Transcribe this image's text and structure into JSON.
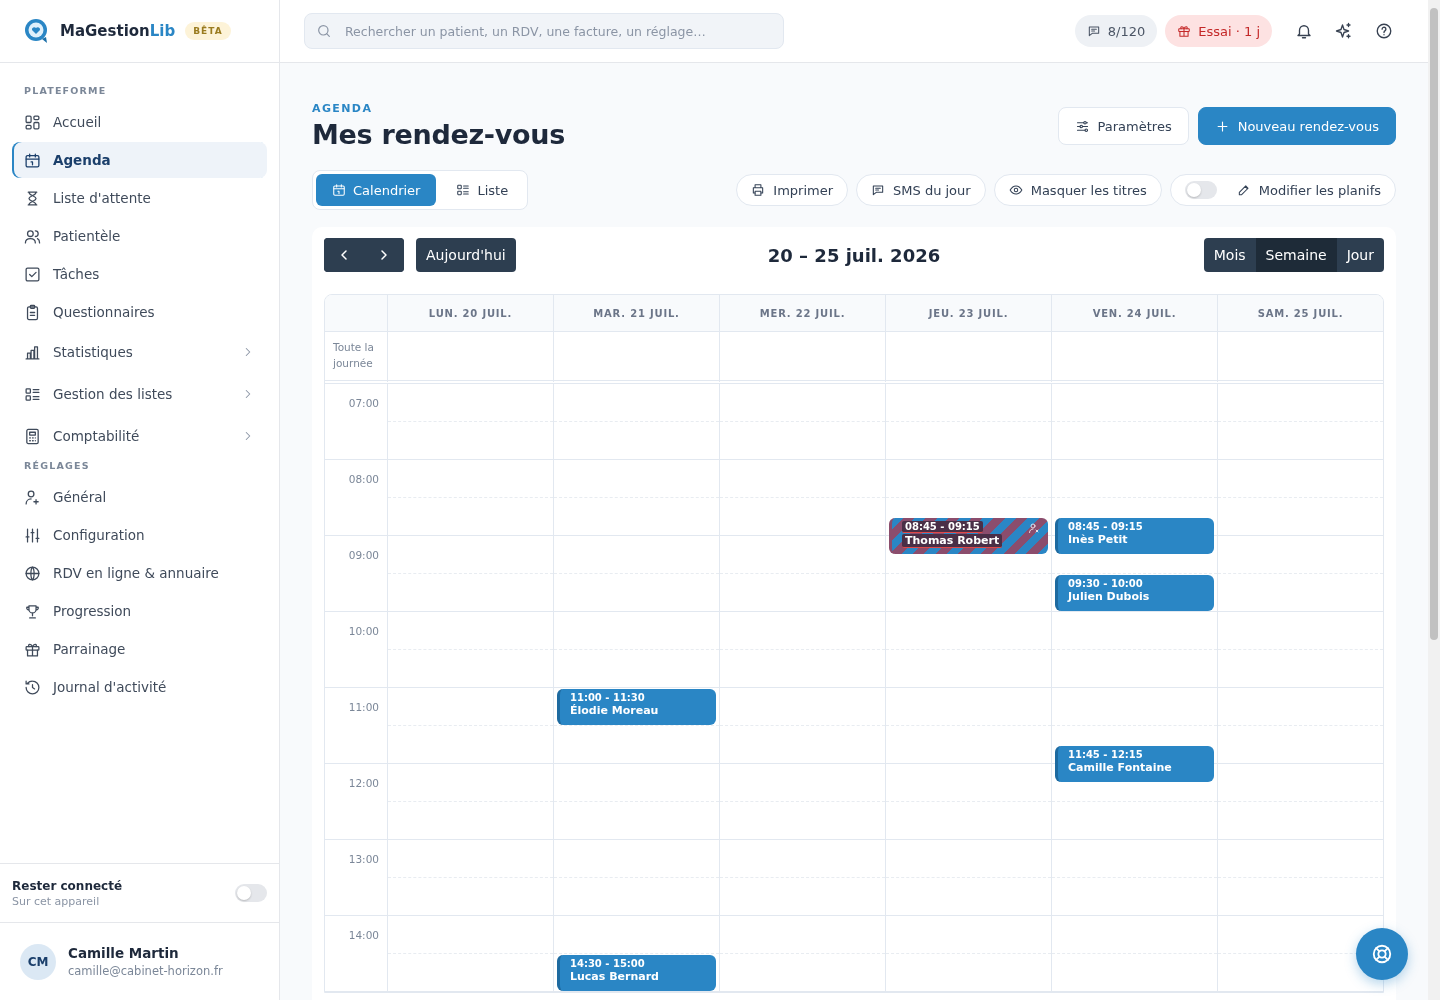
{
  "sidebar": {
    "brand": {
      "name_main": "MaGestion",
      "name_accent": "Lib",
      "badge": "BÊTA"
    },
    "sections": [
      {
        "title": "PLATEFORME",
        "items": [
          {
            "label": "Accueil",
            "kind": "link",
            "selected": false
          },
          {
            "label": "Agenda",
            "kind": "link",
            "selected": true
          },
          {
            "label": "Liste d'attente",
            "kind": "link",
            "selected": false
          },
          {
            "label": "Patientèle",
            "kind": "link",
            "selected": false
          },
          {
            "label": "Tâches",
            "kind": "link",
            "selected": false
          },
          {
            "label": "Questionnaires",
            "kind": "link",
            "selected": false
          },
          {
            "label": "Statistiques",
            "kind": "group",
            "selected": false
          },
          {
            "label": "Gestion des listes",
            "kind": "group",
            "selected": false
          },
          {
            "label": "Comptabilité",
            "kind": "group",
            "selected": false
          }
        ]
      },
      {
        "title": "RÉGLAGES",
        "items": [
          {
            "label": "Général",
            "kind": "link",
            "selected": false
          },
          {
            "label": "Configuration",
            "kind": "link",
            "selected": false
          },
          {
            "label": "RDV en ligne & annuaire",
            "kind": "link",
            "selected": false
          },
          {
            "label": "Progression",
            "kind": "link",
            "selected": false
          },
          {
            "label": "Parrainage",
            "kind": "link",
            "selected": false
          },
          {
            "label": "Journal d'activité",
            "kind": "link",
            "selected": false
          }
        ]
      }
    ],
    "stay_connected": {
      "label": "Rester connecté",
      "hint": "Sur cet appareil",
      "on": false
    },
    "user": {
      "initials": "CM",
      "name": "Camille Martin",
      "email": "camille@cabinet-horizon.fr"
    }
  },
  "topbar": {
    "search": {
      "placeholder": "Rechercher un patient, un RDV, une facture, un réglage…"
    },
    "sms_counter": "8/120",
    "trial_badge": "Essai · 1 j"
  },
  "header": {
    "eyebrow": "AGENDA",
    "title": "Mes rendez-vous",
    "buttons": [
      {
        "label": "Paramètres",
        "kind": "secondary"
      },
      {
        "label": "Nouveau rendez-vous",
        "kind": "primary"
      }
    ],
    "views": [
      {
        "label": "Calendrier",
        "selected": true
      },
      {
        "label": "Liste",
        "selected": false
      }
    ],
    "actions": [
      {
        "label": "Imprimer",
        "kind": "button"
      },
      {
        "label": "SMS du jour",
        "kind": "button"
      },
      {
        "label": "Masquer les titres",
        "kind": "button"
      },
      {
        "label": "Modifier les planifs",
        "kind": "toggle",
        "on": false
      }
    ]
  },
  "calendar": {
    "today": "Aujourd'hui",
    "range": "20 – 25 juil. 2026",
    "views": [
      {
        "label": "Mois",
        "selected": false
      },
      {
        "label": "Semaine",
        "selected": true
      },
      {
        "label": "Jour",
        "selected": false
      }
    ],
    "all_day_label": "Toute la journée",
    "hours": [
      "07:00",
      "08:00",
      "09:00",
      "10:00",
      "11:00",
      "12:00",
      "13:00",
      "14:00"
    ],
    "days": [
      {
        "label": "LUN. 20 JUIL."
      },
      {
        "label": "MAR. 21 JUIL.",
        "events": [
          {
            "time": "11:00 - 11:30",
            "patient": "Élodie Moreau",
            "cancelled": false
          },
          {
            "time": "14:30 - 15:00",
            "patient": "Lucas Bernard",
            "cancelled": false
          }
        ]
      },
      {
        "label": "MER. 22 JUIL."
      },
      {
        "label": "JEU. 23 JUIL.",
        "events": [
          {
            "time": "08:45 - 09:15",
            "patient": "Thomas Robert",
            "cancelled": true
          }
        ]
      },
      {
        "label": "VEN. 24 JUIL.",
        "events": [
          {
            "time": "08:45 - 09:15",
            "patient": "Inès Petit",
            "cancelled": false
          },
          {
            "time": "09:30 - 10:00",
            "patient": "Julien Dubois",
            "cancelled": false
          },
          {
            "time": "11:45 - 12:15",
            "patient": "Camille Fontaine",
            "cancelled": false
          }
        ]
      },
      {
        "label": "SAM. 25 JUIL."
      }
    ]
  }
}
